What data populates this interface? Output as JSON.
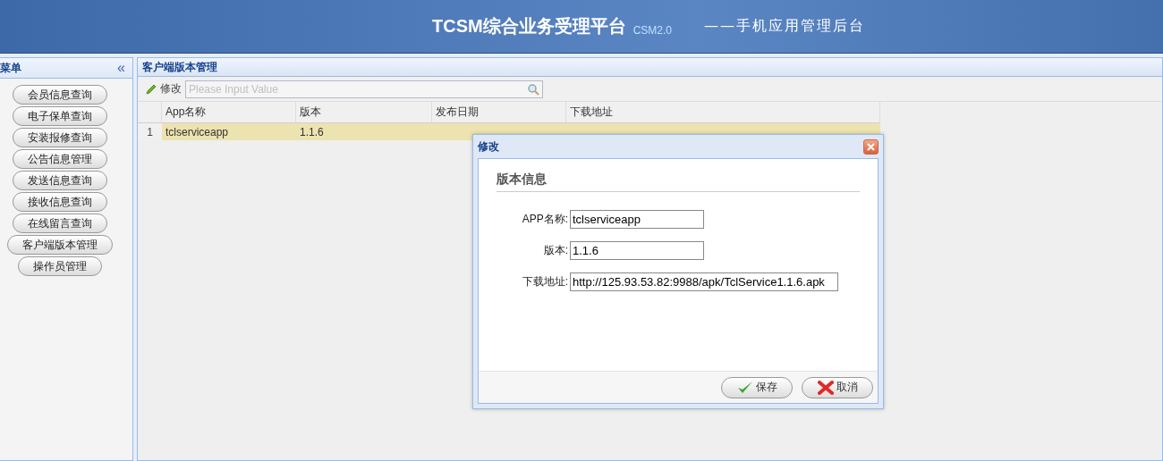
{
  "header": {
    "title": "TCSM综合业务受理平台",
    "version": "CSM2.0",
    "subtitle": "——手机应用管理后台"
  },
  "sidebar": {
    "title": "菜单",
    "collapse": "«",
    "items": [
      {
        "label": "会员信息查询"
      },
      {
        "label": "电子保单查询"
      },
      {
        "label": "安装报修查询"
      },
      {
        "label": "公告信息管理"
      },
      {
        "label": "发送信息查询"
      },
      {
        "label": "接收信息查询"
      },
      {
        "label": "在线留言查询"
      },
      {
        "label": "客户端版本管理"
      },
      {
        "label": "操作员管理"
      }
    ]
  },
  "panel": {
    "title": "客户端版本管理",
    "toolbar": {
      "edit": "修改",
      "search_placeholder": "Please Input Value"
    },
    "table": {
      "columns": [
        "App名称",
        "版本",
        "发布日期",
        "下载地址"
      ],
      "rows": [
        {
          "index": "1",
          "selected": true,
          "cells": [
            "tclserviceapp",
            "1.1.6"
          ]
        }
      ]
    }
  },
  "dialog": {
    "title": "修改",
    "section": "版本信息",
    "fields": [
      {
        "label": "APP名称:",
        "value": "tclserviceapp"
      },
      {
        "label": "版本:",
        "value": "1.1.6"
      },
      {
        "label": "下载地址:",
        "value": "http://125.93.53.82:9988/apk/TclService1.1.6.apk"
      }
    ],
    "buttons": [
      {
        "kind": "save",
        "label": "保存"
      },
      {
        "kind": "cancel",
        "label": "取消"
      }
    ]
  }
}
